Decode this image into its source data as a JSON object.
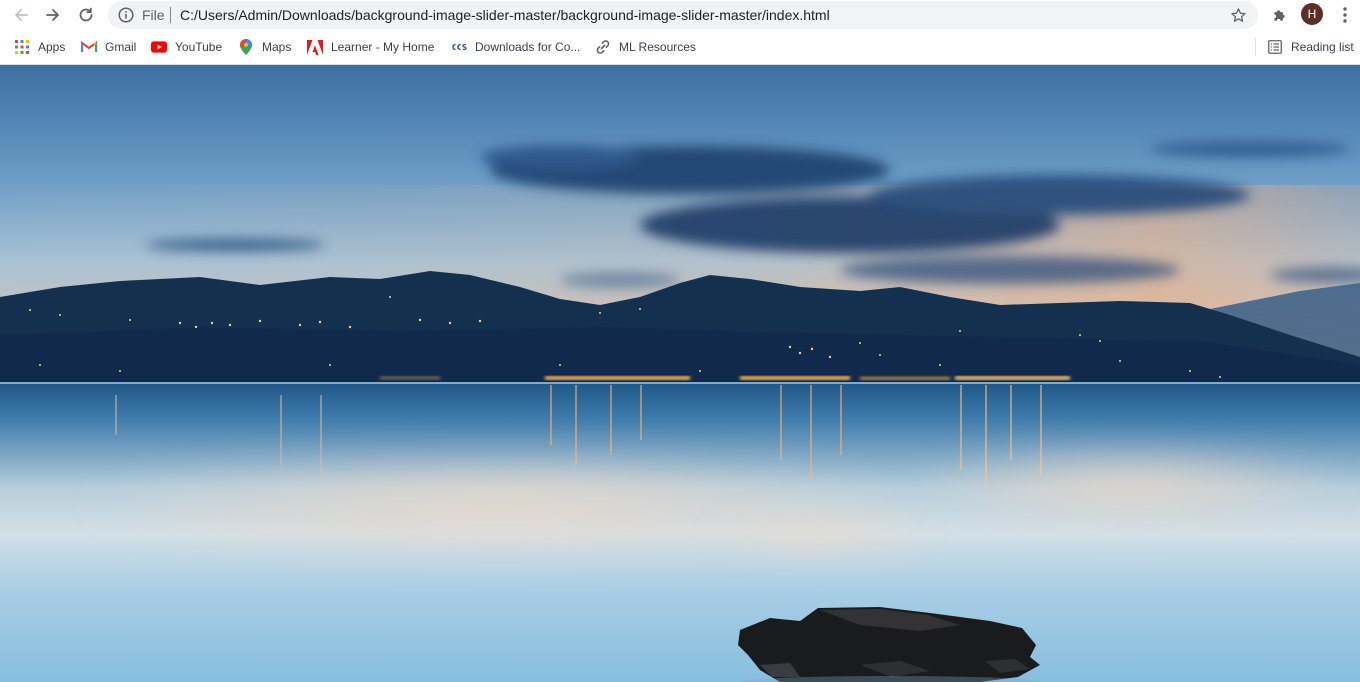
{
  "browser": {
    "url_scheme": "File",
    "url": "C:/Users/Admin/Downloads/background-image-slider-master/background-image-slider-master/index.html",
    "profile_initial": "H",
    "profile_color": "#5b2e26"
  },
  "bookmarks": [
    {
      "label": "Apps",
      "icon": "apps-grid-icon"
    },
    {
      "label": "Gmail",
      "icon": "gmail-icon"
    },
    {
      "label": "YouTube",
      "icon": "youtube-icon"
    },
    {
      "label": "Maps",
      "icon": "maps-pin-icon"
    },
    {
      "label": "Learner - My Home",
      "icon": "adobe-icon"
    },
    {
      "label": "Downloads for Co...",
      "icon": "downloads-site-icon"
    },
    {
      "label": "ML Resources",
      "icon": "link-icon"
    }
  ],
  "reading_list": {
    "label": "Reading list",
    "icon": "reading-list-icon"
  },
  "page": {
    "image": "lake-at-dusk-background",
    "colors": {
      "sky_top": "#3d6fa3",
      "sky_horizon": "#e9b58f",
      "mountains": "#14304f",
      "water": "#8fc1df"
    }
  }
}
